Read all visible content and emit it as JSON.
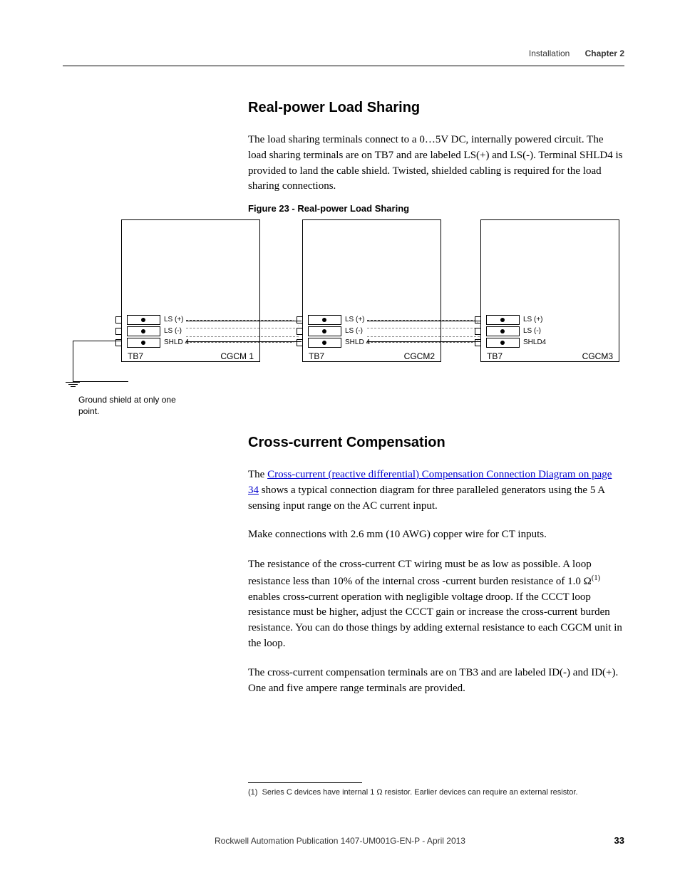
{
  "header": {
    "section": "Installation",
    "chapter": "Chapter 2"
  },
  "section1": {
    "heading": "Real-power Load Sharing",
    "paragraph": "The load sharing terminals connect to a 0…5V DC, internally powered circuit. The load sharing terminals are on TB7 and are labeled LS(+) and LS(-). Terminal SHLD4 is provided to land the cable shield. Twisted, shielded cabling is required for the load sharing connections."
  },
  "figure": {
    "caption": "Figure 23 - Real-power Load Sharing",
    "terminal_labels": {
      "row1": "LS (+)",
      "row2": "LS (-)",
      "row3": "SHLD 4",
      "row3_alt": "SHLD4"
    },
    "modules": {
      "m1": {
        "tb": "TB7",
        "name": "CGCM 1"
      },
      "m2": {
        "tb": "TB7",
        "name": "CGCM2"
      },
      "m3": {
        "tb": "TB7",
        "name": "CGCM3"
      }
    },
    "ground_note": "Ground shield at only one point."
  },
  "section2": {
    "heading": "Cross-current Compensation",
    "p1_pre": "The ",
    "p1_link": "Cross-current (reactive differential) Compensation Connection Diagram on page 34",
    "p1_post": " shows a typical connection diagram for three paralleled generators using the 5 A sensing input range on the AC current input.",
    "p2": "Make connections with 2.6 mm (10 AWG) copper wire for CT inputs.",
    "p3_a": "The resistance of the cross-current CT wiring must be as low as possible. A loop resistance less than 10% of the internal cross -current burden resistance of 1.0 Ω",
    "p3_sup": "(1)",
    "p3_b": " enables cross-current operation with negligible voltage droop. If the CCCT loop resistance must be higher, adjust the CCCT gain or increase the cross-current burden resistance. You can do those things by adding external resistance to each CGCM unit in the loop.",
    "p4": "The cross-current compensation terminals are on TB3 and are labeled ID(-) and ID(+). One and five ampere range terminals are provided."
  },
  "footnote": {
    "marker": "(1)",
    "text": "Series C devices have internal 1 Ω resistor. Earlier devices can require an external resistor."
  },
  "footer": {
    "publication": "Rockwell Automation Publication 1407-UM001G-EN-P - April 2013",
    "page": "33"
  }
}
